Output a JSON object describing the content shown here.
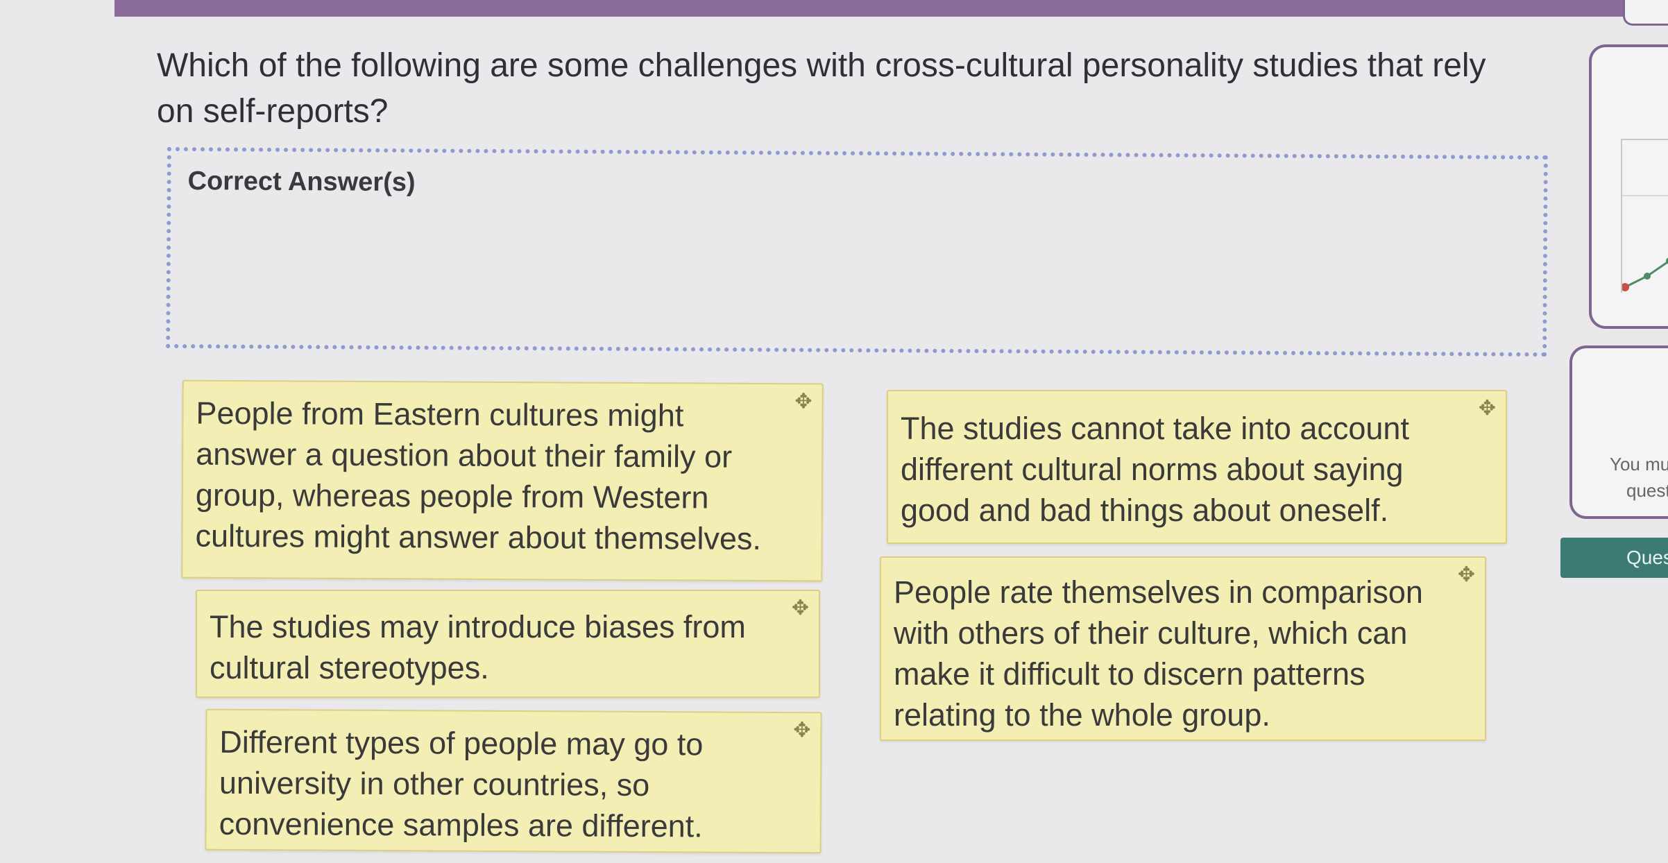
{
  "question": {
    "text": "Which of the following are some challenges with cross-cultural personality studies that rely on self-reports?"
  },
  "dropzone": {
    "title": "Correct Answer(s)"
  },
  "cards": [
    {
      "text": "People from Eastern cultures might answer a question about their family or group, whereas people from Western cultures might answer about themselves."
    },
    {
      "text": "The studies may introduce biases from cultural stereotypes."
    },
    {
      "text": "Different types of people may go to university in other countries, so convenience samples are different."
    },
    {
      "text": "The studies cannot take into account different cultural norms about saying good and bad things about oneself."
    },
    {
      "text": "People rate themselves in comparison with others of their culture, which can make it difficult to discern patterns relating to the whole group."
    }
  ],
  "sidebar": {
    "notice_line1": "You mu",
    "notice_line2": "quest",
    "button_label": "Ques"
  },
  "icons": {
    "move": "move-icon"
  },
  "colors": {
    "topbar": "#8a6b9a",
    "card_bg": "#f3eeb4",
    "dropzone_border": "#8f9bd0",
    "button_bg": "#3b7b73"
  }
}
